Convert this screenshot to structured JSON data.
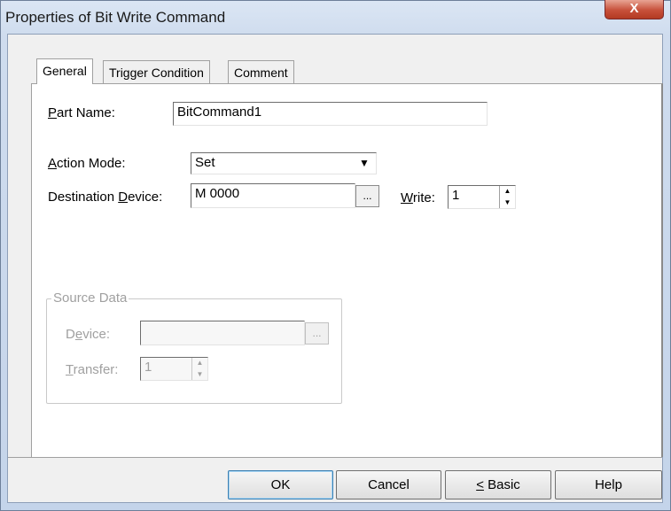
{
  "window": {
    "title": "Properties of Bit Write Command",
    "close_glyph": "X"
  },
  "tabs": [
    {
      "label": "General",
      "active": true
    },
    {
      "label": "Trigger Condition",
      "active": false
    },
    {
      "label": "Comment",
      "active": false
    }
  ],
  "general": {
    "part_name": {
      "label_acc": "P",
      "label_rest": "art Name:",
      "value": "BitCommand1"
    },
    "action_mode": {
      "label_acc": "A",
      "label_rest": "ction Mode:",
      "value": "Set"
    },
    "destination_device": {
      "label_pre": "Destination ",
      "label_acc": "D",
      "label_rest": "evice:",
      "value": "M 0000",
      "browse": "..."
    },
    "write": {
      "label_acc": "W",
      "label_rest": "rite:",
      "value": "1"
    }
  },
  "source_data": {
    "caption": "Source Data",
    "device": {
      "label_pre": "D",
      "label_acc": "e",
      "label_rest": "vice:",
      "value": "",
      "browse": "..."
    },
    "transfer": {
      "label_acc": "T",
      "label_rest": "ransfer:",
      "value": "1"
    }
  },
  "buttons": {
    "ok": "OK",
    "cancel": "Cancel",
    "basic_acc": "<",
    "basic_rest": " Basic",
    "help": "Help"
  },
  "icons": {
    "dropdown": "chevron-down-icon",
    "spin_up": "triangle-up-icon",
    "spin_down": "triangle-down-icon",
    "close": "close-icon"
  }
}
